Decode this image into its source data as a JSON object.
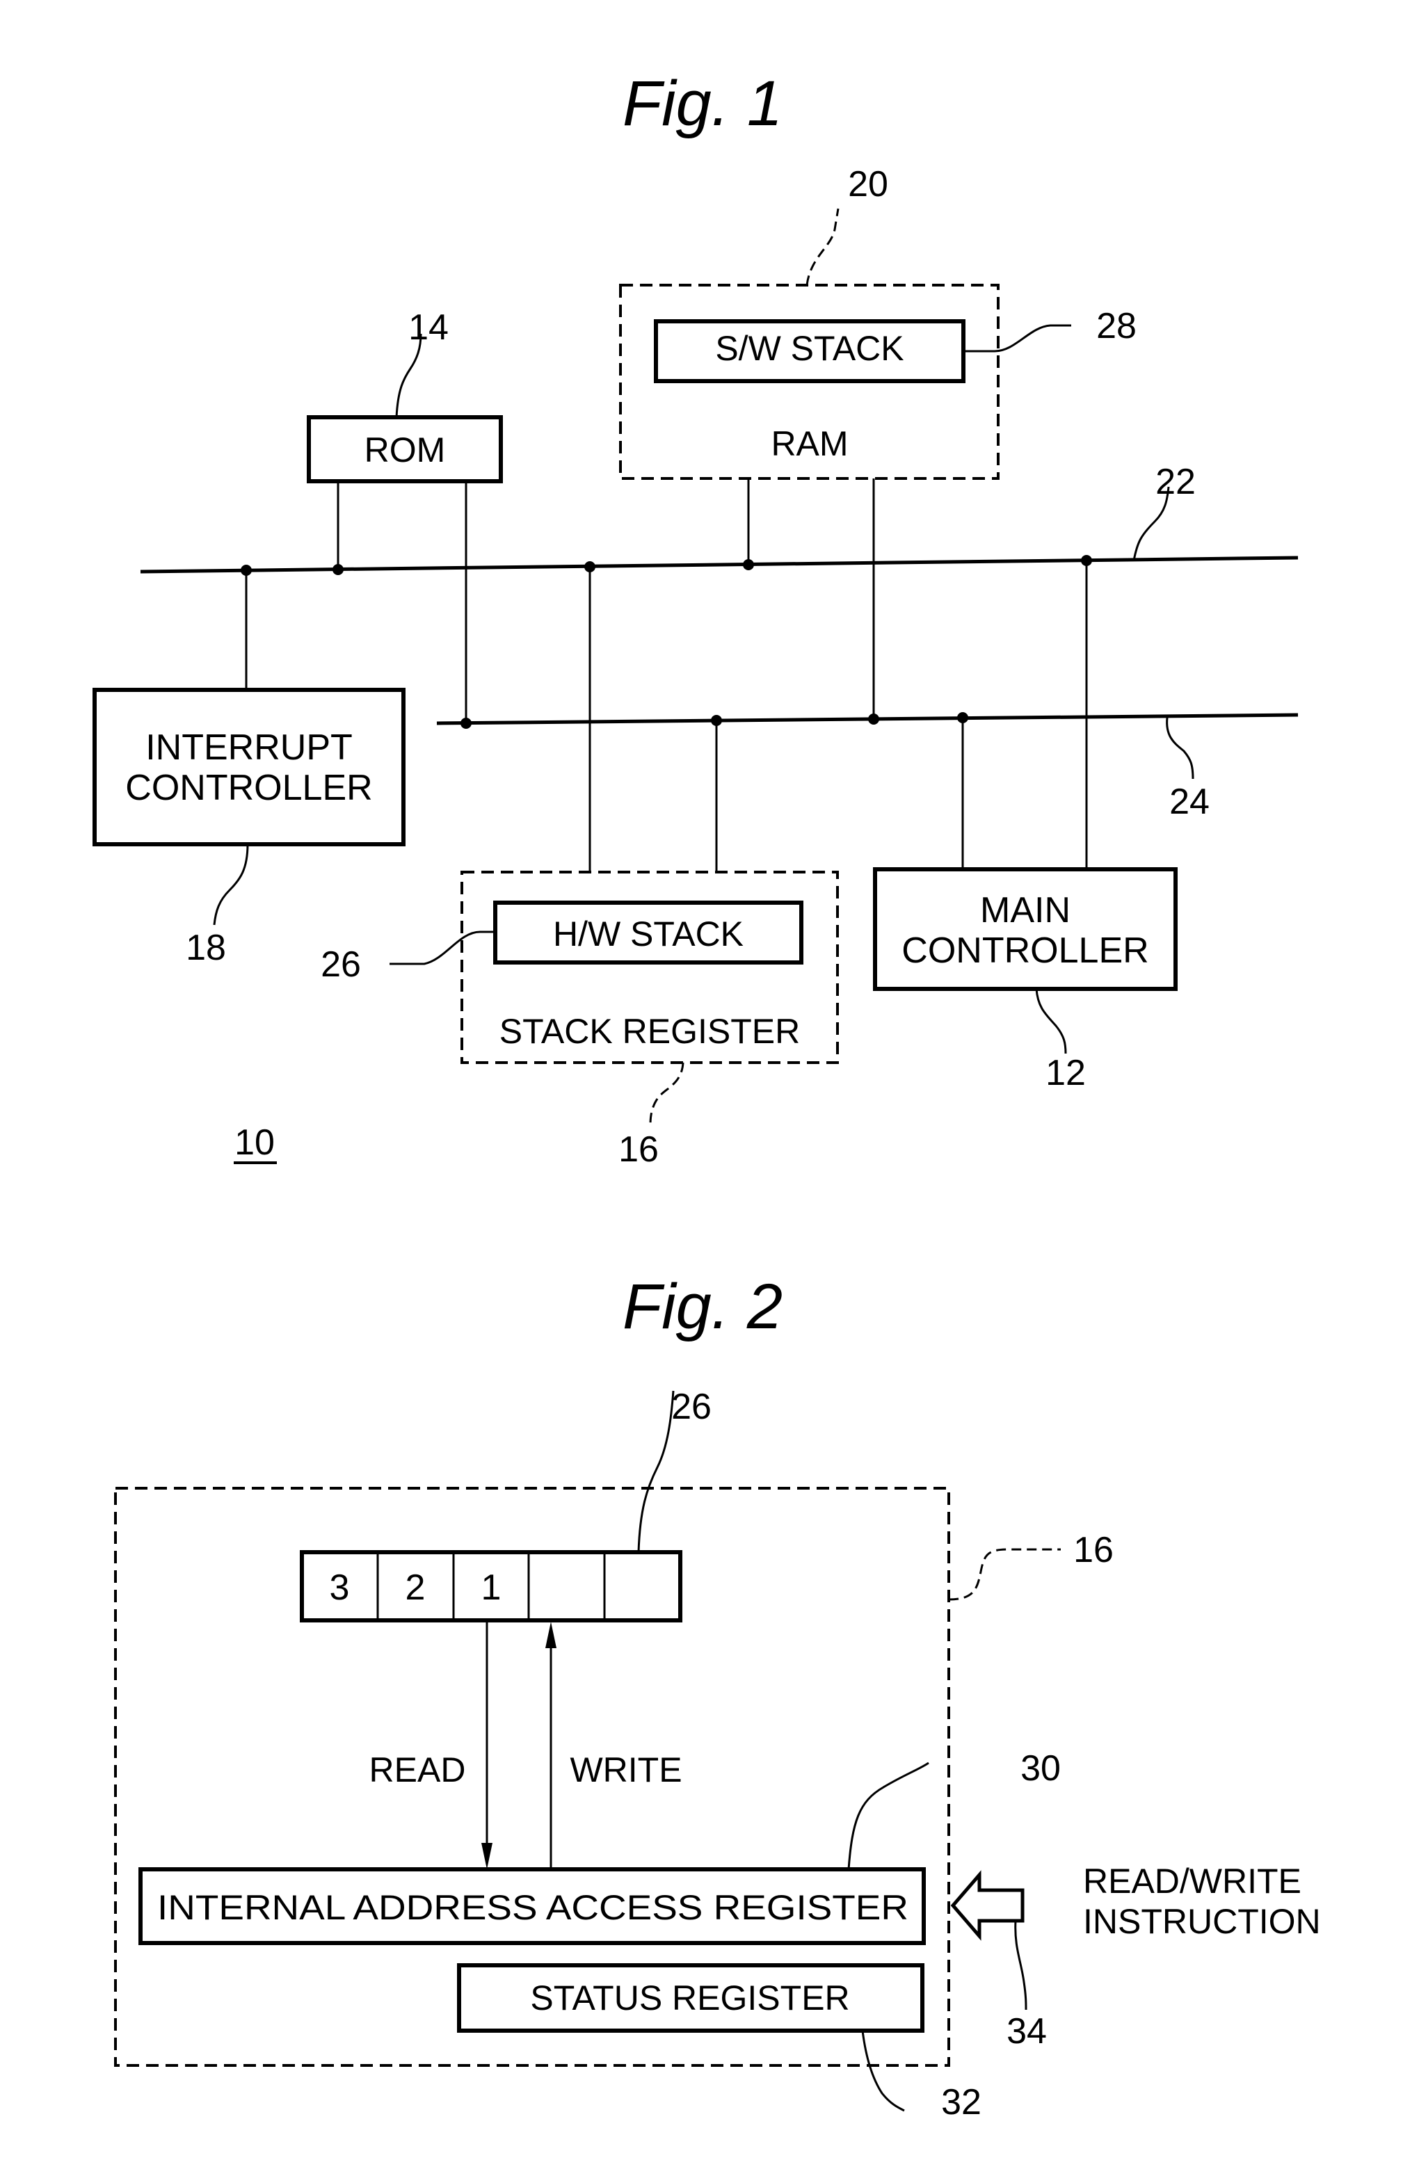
{
  "figure1": {
    "title": "Fig. 1",
    "system_ref": "10",
    "blocks": {
      "ram": {
        "label": "RAM",
        "ref": "20"
      },
      "sw_stack": {
        "label": "S/W STACK",
        "ref": "28"
      },
      "rom": {
        "label": "ROM",
        "ref": "14"
      },
      "interrupt_controller": {
        "line1": "INTERRUPT",
        "line2": "CONTROLLER",
        "ref": "18"
      },
      "stack_register": {
        "label": "STACK REGISTER",
        "ref": "16"
      },
      "hw_stack": {
        "label": "H/W STACK",
        "ref": "26"
      },
      "main_controller": {
        "line1": "MAIN",
        "line2": "CONTROLLER",
        "ref": "12"
      }
    },
    "buses": {
      "bus_a": {
        "ref": "22"
      },
      "bus_b": {
        "ref": "24"
      }
    }
  },
  "figure2": {
    "title": "Fig. 2",
    "stack_register_ref": "16",
    "hw_stack": {
      "ref": "26",
      "cells": [
        "3",
        "2",
        "1",
        "",
        ""
      ]
    },
    "read_label": "READ",
    "write_label": "WRITE",
    "internal_address_access_register": {
      "label": "INTERNAL ADDRESS ACCESS REGISTER",
      "ref": "30"
    },
    "status_register": {
      "label": "STATUS REGISTER",
      "ref": "32"
    },
    "instruction": {
      "line1": "READ/WRITE",
      "line2": "INSTRUCTION",
      "ref": "34"
    }
  }
}
